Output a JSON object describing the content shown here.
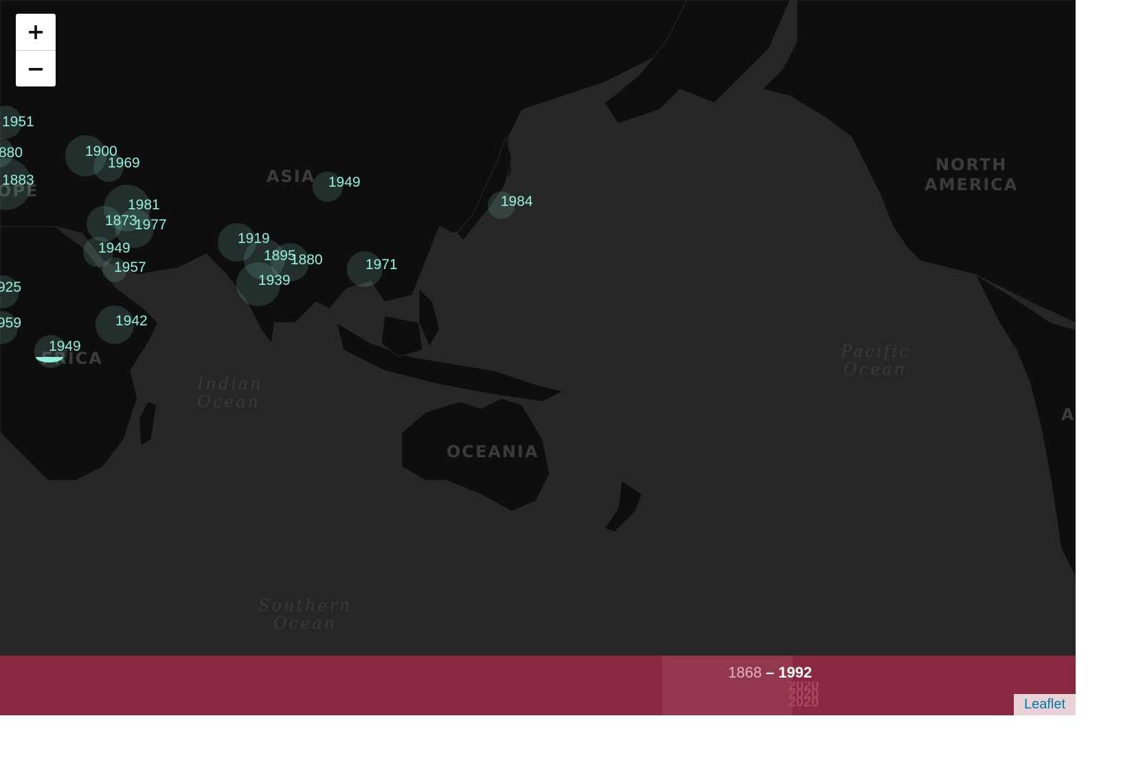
{
  "map": {
    "region_labels": [
      "ASIA",
      "NORTH",
      "AMERICA",
      "OCEANIA",
      "FRICA",
      "OPE",
      "A"
    ],
    "ocean_labels": [
      "Indian",
      "Ocean",
      "Pacific",
      "Ocean",
      "Southern",
      "Ocean"
    ],
    "markers": [
      "1951",
      "880",
      "1883",
      "1900",
      "1969",
      "1981",
      "1873",
      "1977",
      "1949",
      "1957",
      "925",
      "959",
      "1942",
      "1949",
      "1949",
      "1919",
      "1895",
      "1880",
      "1939",
      "1971",
      "1984"
    ],
    "marker_color": "#96f0df",
    "land_color": "#0e0e0e",
    "ocean_color": "#262626"
  },
  "zoom": {
    "in_label": "+",
    "out_label": "−"
  },
  "timeline": {
    "start": "1868",
    "separator": "–",
    "end": "1992",
    "ghost_years": [
      "2020",
      "2020",
      "2020"
    ],
    "color": "#8a2741"
  },
  "attribution": {
    "label": "Leaflet"
  }
}
